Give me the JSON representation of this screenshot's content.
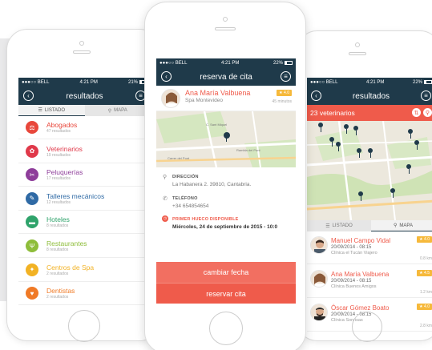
{
  "colors": {
    "navy": "#1f3a4a",
    "coral": "#ef5b4b",
    "star": "#f6b93b"
  },
  "left": {
    "status": {
      "carrier": "●●●○○ BELL ",
      "time": "4:21 PM",
      "battery": "21%"
    },
    "title": "resultados",
    "tabs": [
      {
        "label": "LISTADO"
      },
      {
        "label": "MAPA"
      }
    ],
    "categories": [
      {
        "name": "Abogados",
        "count": "47 resultados",
        "color": "#e8473b",
        "icon": "gavel-icon",
        "glyph": "⚖"
      },
      {
        "name": "Veterinarios",
        "count": "19 resultados",
        "color": "#e0394a",
        "icon": "paw-icon",
        "glyph": "✿"
      },
      {
        "name": "Peluquerías",
        "count": "17 resultados",
        "color": "#8e3d9a",
        "icon": "scissors-icon",
        "glyph": "✂"
      },
      {
        "name": "Talleres mecánicos",
        "count": "12 resultados",
        "color": "#2f6aa5",
        "icon": "wrench-icon",
        "glyph": "✎"
      },
      {
        "name": "Hoteles",
        "count": "8 resultados",
        "color": "#2fa36b",
        "icon": "bed-icon",
        "glyph": "▬"
      },
      {
        "name": "Restaurantes",
        "count": "8 resultados",
        "color": "#8ebd3a",
        "icon": "cutlery-icon",
        "glyph": "Ψ"
      },
      {
        "name": "Centros de Spa",
        "count": "2 resultados",
        "color": "#f2b224",
        "icon": "spa-icon",
        "glyph": "✦"
      },
      {
        "name": "Dentistas",
        "count": "2 resultados",
        "color": "#f07a26",
        "icon": "tooth-icon",
        "glyph": "♥"
      }
    ]
  },
  "center": {
    "status": {
      "carrier": "●●●○○ BELL ",
      "time": "4:21 PM",
      "battery": "22%"
    },
    "title": "reserva de cita",
    "doctor": {
      "name": "Ana María Valbuena",
      "clinic": "Spa Montevideo",
      "rating": "★ 4.0",
      "distance": "45 minutos"
    },
    "address_label": "DIRECCIÓN",
    "address": "La Habanera 2. 39810, Cantabria.",
    "phone_label": "TELÉFONO",
    "phone": "+34 654854654",
    "slot_label": "PRIMER HUECO DISPONIBLE",
    "slot": "Miércoles, 24 de septiembre de 2015 - 10:0",
    "change_btn": "cambiar fecha",
    "book_btn": "reservar cita",
    "map_labels": [
      "C. Sant Miquel",
      "Carrer del Pont",
      "Rambla del Pont"
    ]
  },
  "right": {
    "status": {
      "carrier": "●●●○○ BELL ",
      "time": "4:21 PM",
      "battery": "22%"
    },
    "title": "resultados",
    "results_count": "23 veterinarios",
    "tabs": [
      {
        "label": "LISTADO"
      },
      {
        "label": "MAPA"
      }
    ],
    "doctors": [
      {
        "name": "Manuel Campo Vidal",
        "date": "20/09/2014 - 08:15",
        "clinic": "Clínica el Tucán Viajero",
        "rating": "★ 4.0",
        "distance": "0.8 km"
      },
      {
        "name": "Ana María Valbuena",
        "date": "20/09/2014 - 08:15",
        "clinic": "Clínica Buenos Amigos",
        "rating": "★ 4.5",
        "distance": "1.2 km"
      },
      {
        "name": "Óscar Gómez Boato",
        "date": "20/09/2014 - 08:15",
        "clinic": "Clínica Sonrisas",
        "rating": "★ 4.0",
        "distance": "2.8 km"
      }
    ]
  }
}
